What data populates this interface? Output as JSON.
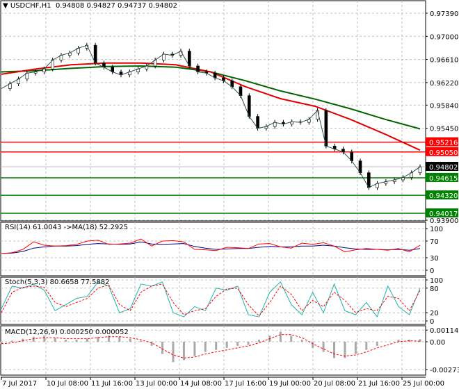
{
  "header": {
    "symbol": "USDCHF,H1",
    "ohlc": "0.94808 0.94827 0.94737 0.94802"
  },
  "chart_data": [
    {
      "type": "line",
      "pane": "price",
      "y_ticks": [
        "0.97390",
        "0.97000",
        "0.96610",
        "0.96220",
        "0.95840",
        "0.95450",
        "0.93900"
      ],
      "ylim": [
        0.939,
        0.9739
      ],
      "x_ticks": [
        "7 Jul 2017",
        "10 Jul 08:00",
        "11 Jul 16:00",
        "13 Jul 00:00",
        "14 Jul 08:00",
        "17 Jul 16:00",
        "19 Jul 00:00",
        "20 Jul 08:00",
        "21 Jul 16:00",
        "25 Jul 00:00"
      ],
      "close": [
        0.9612,
        0.962,
        0.9628,
        0.9638,
        0.964,
        0.9645,
        0.966,
        0.9668,
        0.9672,
        0.968,
        0.9685,
        0.9655,
        0.9648,
        0.964,
        0.9635,
        0.964,
        0.9645,
        0.965,
        0.966,
        0.967,
        0.9668,
        0.9675,
        0.965,
        0.964,
        0.9638,
        0.963,
        0.9625,
        0.9615,
        0.96,
        0.9565,
        0.9545,
        0.9548,
        0.9555,
        0.9552,
        0.9556,
        0.9555,
        0.956,
        0.9575,
        0.9515,
        0.951,
        0.9505,
        0.949,
        0.947,
        0.9445,
        0.9452,
        0.9455,
        0.9458,
        0.9462,
        0.947,
        0.948
      ],
      "ma_red": [
        0.9636,
        0.9645,
        0.9652,
        0.9655,
        0.9655,
        0.9652,
        0.964,
        0.9615,
        0.9595,
        0.9582,
        0.956,
        0.9535,
        0.9508
      ],
      "ma_green": [
        0.964,
        0.9642,
        0.9646,
        0.9649,
        0.965,
        0.9648,
        0.964,
        0.9625,
        0.9608,
        0.9594,
        0.9578,
        0.956,
        0.9544
      ],
      "levels": [
        {
          "label": "0.95216",
          "value": 0.95216,
          "color": "#ff0000"
        },
        {
          "label": "0.95050",
          "value": 0.9505,
          "color": "#ff0000"
        },
        {
          "label": "0.94615",
          "value": 0.94615,
          "color": "#008000"
        },
        {
          "label": "0.94320",
          "value": 0.9432,
          "color": "#008000"
        },
        {
          "label": "0.94017",
          "value": 0.94017,
          "color": "#008000"
        }
      ],
      "current": {
        "label": "0.94802",
        "value": 0.94802,
        "color": "#000000"
      }
    },
    {
      "type": "line",
      "pane": "rsi",
      "title": "RSI(14) 61.0043  ->MA(18) 52.2925",
      "ylim": [
        0,
        100
      ],
      "y_ticks": [
        "100",
        "70",
        "30",
        "0"
      ],
      "rsi": [
        40,
        42,
        50,
        68,
        60,
        58,
        59,
        62,
        70,
        72,
        62,
        63,
        65,
        75,
        58,
        70,
        71,
        68,
        50,
        49,
        47,
        55,
        54,
        52,
        63,
        64,
        56,
        53,
        65,
        62,
        66,
        58,
        44,
        49,
        52,
        50,
        48,
        52,
        44,
        60
      ],
      "ma": [
        40,
        41,
        45,
        53,
        56,
        58,
        58,
        59,
        62,
        64,
        63,
        62,
        63,
        68,
        63,
        62,
        63,
        64,
        57,
        53,
        50,
        51,
        52,
        52,
        55,
        57,
        56,
        56,
        58,
        58,
        60,
        58,
        54,
        51,
        50,
        50,
        49,
        50,
        48,
        52
      ]
    },
    {
      "type": "line",
      "pane": "stoch",
      "title": "Stoch(5,3,3) 80.6658 77.5882",
      "ylim": [
        0,
        100
      ],
      "y_ticks": [
        "100",
        "80",
        "20",
        "0"
      ],
      "main": [
        30,
        85,
        80,
        90,
        75,
        25,
        40,
        55,
        60,
        95,
        85,
        20,
        30,
        90,
        85,
        95,
        20,
        10,
        35,
        25,
        80,
        75,
        85,
        15,
        10,
        70,
        95,
        40,
        15,
        70,
        20,
        90,
        25,
        15,
        45,
        10,
        85,
        35,
        15,
        80
      ],
      "signal": [
        20,
        70,
        82,
        85,
        82,
        45,
        35,
        45,
        55,
        80,
        88,
        40,
        25,
        70,
        85,
        90,
        45,
        15,
        25,
        30,
        60,
        78,
        80,
        40,
        12,
        45,
        85,
        65,
        25,
        50,
        35,
        70,
        50,
        20,
        30,
        25,
        60,
        55,
        25,
        75
      ]
    },
    {
      "type": "bar",
      "pane": "macd",
      "title": "MACD(12,26,9) 0.000250 0.000052",
      "ylim": [
        -0.002731,
        0.001145
      ],
      "y_ticks": [
        "0.001145",
        "0.00",
        "-0.002731"
      ],
      "histogram": [
        -0.0002,
        0.0001,
        0.0003,
        0.0005,
        0.0006,
        0.0004,
        0.0002,
        0.0002,
        0.0003,
        0.0005,
        0.0006,
        0.0005,
        0.0003,
        0.0001,
        -0.0004,
        -0.0012,
        -0.002,
        -0.0018,
        -0.0014,
        -0.001,
        -0.0008,
        -0.0006,
        -0.0004,
        -0.0003,
        0.0002,
        0.0006,
        0.001,
        0.0006,
        0.0002,
        -0.0006,
        -0.001,
        -0.0016,
        -0.0016,
        -0.0012,
        -0.0008,
        -0.0004,
        0.0,
        0.0002,
        0.0002,
        0.00025
      ],
      "signal": [
        -0.0002,
        -0.0001,
        0.0001,
        0.0003,
        0.0004,
        0.0004,
        0.0003,
        0.0003,
        0.0003,
        0.0004,
        0.0005,
        0.0005,
        0.0004,
        0.0002,
        -0.0001,
        -0.0007,
        -0.0013,
        -0.0016,
        -0.0015,
        -0.0012,
        -0.001,
        -0.0008,
        -0.0006,
        -0.0004,
        -0.0001,
        0.0003,
        0.0007,
        0.0007,
        0.0004,
        -0.0002,
        -0.0007,
        -0.0012,
        -0.0014,
        -0.0013,
        -0.001,
        -0.0006,
        -0.0003,
        0.0,
        0.0001,
        5e-05
      ]
    }
  ]
}
